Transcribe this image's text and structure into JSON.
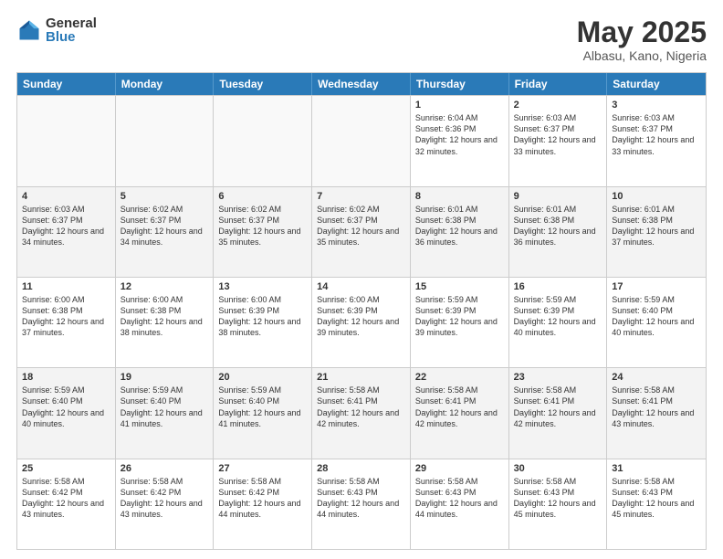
{
  "logo": {
    "general": "General",
    "blue": "Blue"
  },
  "header": {
    "month": "May 2025",
    "location": "Albasu, Kano, Nigeria"
  },
  "days": [
    "Sunday",
    "Monday",
    "Tuesday",
    "Wednesday",
    "Thursday",
    "Friday",
    "Saturday"
  ],
  "weeks": [
    [
      {
        "day": "",
        "empty": true
      },
      {
        "day": "",
        "empty": true
      },
      {
        "day": "",
        "empty": true
      },
      {
        "day": "",
        "empty": true
      },
      {
        "day": "1",
        "sunrise": "Sunrise: 6:04 AM",
        "sunset": "Sunset: 6:36 PM",
        "daylight": "Daylight: 12 hours and 32 minutes."
      },
      {
        "day": "2",
        "sunrise": "Sunrise: 6:03 AM",
        "sunset": "Sunset: 6:37 PM",
        "daylight": "Daylight: 12 hours and 33 minutes."
      },
      {
        "day": "3",
        "sunrise": "Sunrise: 6:03 AM",
        "sunset": "Sunset: 6:37 PM",
        "daylight": "Daylight: 12 hours and 33 minutes."
      }
    ],
    [
      {
        "day": "4",
        "sunrise": "Sunrise: 6:03 AM",
        "sunset": "Sunset: 6:37 PM",
        "daylight": "Daylight: 12 hours and 34 minutes."
      },
      {
        "day": "5",
        "sunrise": "Sunrise: 6:02 AM",
        "sunset": "Sunset: 6:37 PM",
        "daylight": "Daylight: 12 hours and 34 minutes."
      },
      {
        "day": "6",
        "sunrise": "Sunrise: 6:02 AM",
        "sunset": "Sunset: 6:37 PM",
        "daylight": "Daylight: 12 hours and 35 minutes."
      },
      {
        "day": "7",
        "sunrise": "Sunrise: 6:02 AM",
        "sunset": "Sunset: 6:37 PM",
        "daylight": "Daylight: 12 hours and 35 minutes."
      },
      {
        "day": "8",
        "sunrise": "Sunrise: 6:01 AM",
        "sunset": "Sunset: 6:38 PM",
        "daylight": "Daylight: 12 hours and 36 minutes."
      },
      {
        "day": "9",
        "sunrise": "Sunrise: 6:01 AM",
        "sunset": "Sunset: 6:38 PM",
        "daylight": "Daylight: 12 hours and 36 minutes."
      },
      {
        "day": "10",
        "sunrise": "Sunrise: 6:01 AM",
        "sunset": "Sunset: 6:38 PM",
        "daylight": "Daylight: 12 hours and 37 minutes."
      }
    ],
    [
      {
        "day": "11",
        "sunrise": "Sunrise: 6:00 AM",
        "sunset": "Sunset: 6:38 PM",
        "daylight": "Daylight: 12 hours and 37 minutes."
      },
      {
        "day": "12",
        "sunrise": "Sunrise: 6:00 AM",
        "sunset": "Sunset: 6:38 PM",
        "daylight": "Daylight: 12 hours and 38 minutes."
      },
      {
        "day": "13",
        "sunrise": "Sunrise: 6:00 AM",
        "sunset": "Sunset: 6:39 PM",
        "daylight": "Daylight: 12 hours and 38 minutes."
      },
      {
        "day": "14",
        "sunrise": "Sunrise: 6:00 AM",
        "sunset": "Sunset: 6:39 PM",
        "daylight": "Daylight: 12 hours and 39 minutes."
      },
      {
        "day": "15",
        "sunrise": "Sunrise: 5:59 AM",
        "sunset": "Sunset: 6:39 PM",
        "daylight": "Daylight: 12 hours and 39 minutes."
      },
      {
        "day": "16",
        "sunrise": "Sunrise: 5:59 AM",
        "sunset": "Sunset: 6:39 PM",
        "daylight": "Daylight: 12 hours and 40 minutes."
      },
      {
        "day": "17",
        "sunrise": "Sunrise: 5:59 AM",
        "sunset": "Sunset: 6:40 PM",
        "daylight": "Daylight: 12 hours and 40 minutes."
      }
    ],
    [
      {
        "day": "18",
        "sunrise": "Sunrise: 5:59 AM",
        "sunset": "Sunset: 6:40 PM",
        "daylight": "Daylight: 12 hours and 40 minutes."
      },
      {
        "day": "19",
        "sunrise": "Sunrise: 5:59 AM",
        "sunset": "Sunset: 6:40 PM",
        "daylight": "Daylight: 12 hours and 41 minutes."
      },
      {
        "day": "20",
        "sunrise": "Sunrise: 5:59 AM",
        "sunset": "Sunset: 6:40 PM",
        "daylight": "Daylight: 12 hours and 41 minutes."
      },
      {
        "day": "21",
        "sunrise": "Sunrise: 5:58 AM",
        "sunset": "Sunset: 6:41 PM",
        "daylight": "Daylight: 12 hours and 42 minutes."
      },
      {
        "day": "22",
        "sunrise": "Sunrise: 5:58 AM",
        "sunset": "Sunset: 6:41 PM",
        "daylight": "Daylight: 12 hours and 42 minutes."
      },
      {
        "day": "23",
        "sunrise": "Sunrise: 5:58 AM",
        "sunset": "Sunset: 6:41 PM",
        "daylight": "Daylight: 12 hours and 42 minutes."
      },
      {
        "day": "24",
        "sunrise": "Sunrise: 5:58 AM",
        "sunset": "Sunset: 6:41 PM",
        "daylight": "Daylight: 12 hours and 43 minutes."
      }
    ],
    [
      {
        "day": "25",
        "sunrise": "Sunrise: 5:58 AM",
        "sunset": "Sunset: 6:42 PM",
        "daylight": "Daylight: 12 hours and 43 minutes."
      },
      {
        "day": "26",
        "sunrise": "Sunrise: 5:58 AM",
        "sunset": "Sunset: 6:42 PM",
        "daylight": "Daylight: 12 hours and 43 minutes."
      },
      {
        "day": "27",
        "sunrise": "Sunrise: 5:58 AM",
        "sunset": "Sunset: 6:42 PM",
        "daylight": "Daylight: 12 hours and 44 minutes."
      },
      {
        "day": "28",
        "sunrise": "Sunrise: 5:58 AM",
        "sunset": "Sunset: 6:43 PM",
        "daylight": "Daylight: 12 hours and 44 minutes."
      },
      {
        "day": "29",
        "sunrise": "Sunrise: 5:58 AM",
        "sunset": "Sunset: 6:43 PM",
        "daylight": "Daylight: 12 hours and 44 minutes."
      },
      {
        "day": "30",
        "sunrise": "Sunrise: 5:58 AM",
        "sunset": "Sunset: 6:43 PM",
        "daylight": "Daylight: 12 hours and 45 minutes."
      },
      {
        "day": "31",
        "sunrise": "Sunrise: 5:58 AM",
        "sunset": "Sunset: 6:43 PM",
        "daylight": "Daylight: 12 hours and 45 minutes."
      }
    ]
  ]
}
